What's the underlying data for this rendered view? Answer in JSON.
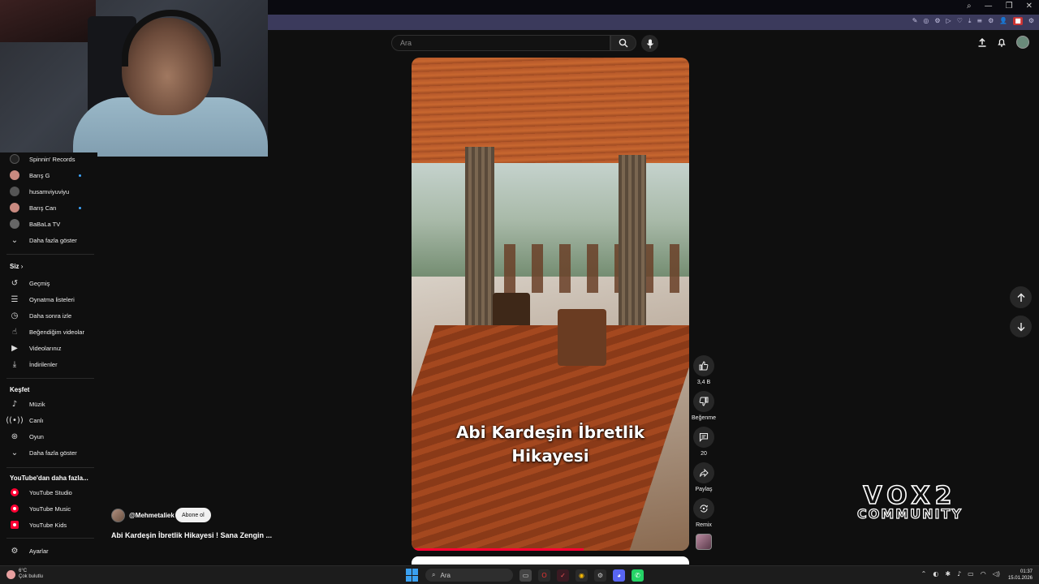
{
  "browser": {
    "window_controls": [
      "⌕",
      "—",
      "❐",
      "✕"
    ],
    "extension_icons": [
      "✎",
      "◎",
      "⚙",
      "▷",
      "♡",
      "⤓",
      "≡",
      "⚙",
      "👤"
    ],
    "extension_badges": [
      "■",
      "⚙"
    ]
  },
  "search": {
    "placeholder": "Ara"
  },
  "sidebar": {
    "subscriptions": [
      {
        "label": "Spinnin' Records",
        "color": "#2a2a2a"
      },
      {
        "label": "Barış G",
        "color": "#c98a80",
        "dot": true
      },
      {
        "label": "husamviyuviyu",
        "color": "#555"
      },
      {
        "label": "Barış Can",
        "color": "#c98a80",
        "dot": true
      },
      {
        "label": "BaBaLa TV",
        "color": "#666"
      },
      {
        "label": "Daha fazla göster"
      }
    ],
    "you_heading": "Siz",
    "you_items": [
      {
        "label": "Geçmiş",
        "icon": "history-icon"
      },
      {
        "label": "Oynatma listeleri",
        "icon": "playlist-icon"
      },
      {
        "label": "Daha sonra izle",
        "icon": "clock-icon"
      },
      {
        "label": "Beğendiğim videolar",
        "icon": "thumb-up-icon"
      },
      {
        "label": "Videolarınız",
        "icon": "video-icon"
      },
      {
        "label": "İndirilenler",
        "icon": "download-icon"
      }
    ],
    "explore_heading": "Keşfet",
    "explore_items": [
      {
        "label": "Müzik",
        "icon": "music-icon"
      },
      {
        "label": "Canlı",
        "icon": "live-icon"
      },
      {
        "label": "Oyun",
        "icon": "gaming-icon"
      },
      {
        "label": "Daha fazla göster",
        "icon": "chevron-down-icon"
      }
    ],
    "more_heading": "YouTube'dan daha fazla...",
    "more_items": [
      {
        "label": "YouTube Studio"
      },
      {
        "label": "YouTube Music"
      },
      {
        "label": "YouTube Kids"
      }
    ],
    "settings_label": "Ayarlar"
  },
  "short": {
    "caption_line1": "Abi Kardeşin İbretlik",
    "caption_line2": "Hikayesi",
    "progress_fraction": 0.62
  },
  "actions": {
    "like_count": "3,4 B",
    "dislike_label": "Beğenme",
    "comment_count": "20",
    "share_label": "Paylaş",
    "remix_label": "Remix"
  },
  "channel": {
    "handle": "@Mehmetaliek",
    "subscribe_label": "Abone ol",
    "video_title": "Abi Kardeşin İbretlik Hikayesi ! Sana Zengin ..."
  },
  "watermark": {
    "line1": "VOX2",
    "line2": "COMMUNITY"
  },
  "taskbar": {
    "weather_temp": "6°C",
    "weather_desc": "Çok bulutlu",
    "search_label": "Ara",
    "time": "01:37",
    "date": "15.01.2026"
  },
  "colors": {
    "accent_red": "#ff0033",
    "bg": "#0f0f0f",
    "toolbar": "#3b3a5c"
  }
}
